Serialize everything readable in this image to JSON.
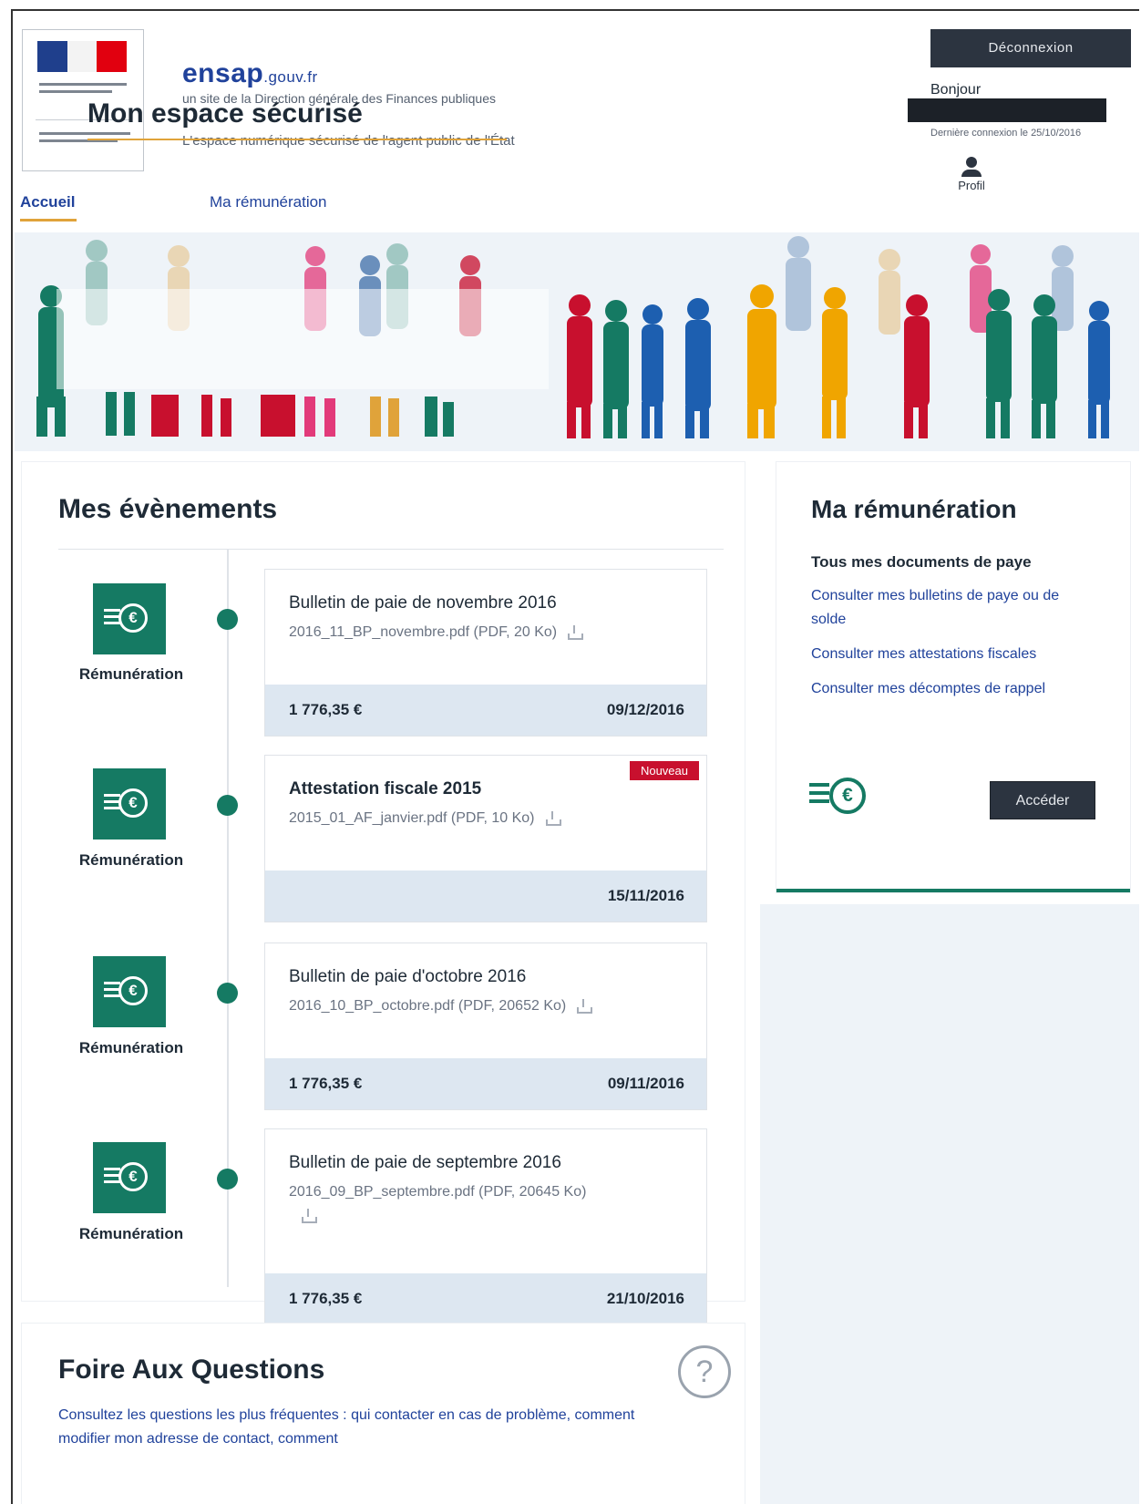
{
  "header": {
    "brand_name": "ensap",
    "brand_domain": ".gouv.fr",
    "brand_subtitle": "un site de la Direction générale des Finances publiques",
    "brand_tagline": "L'espace numérique sécurisé de l'agent public de l'État",
    "logout_label": "Déconnexion",
    "greeting": "Bonjour",
    "last_login": "Dernière connexion le 25/10/2016",
    "profile_label": "Profil"
  },
  "nav": {
    "home": "Accueil",
    "pay": "Ma rémunération"
  },
  "hero": {
    "title": "Mon espace sécurisé"
  },
  "events": {
    "title": "Mes évènements",
    "items": [
      {
        "category": "Rémunération",
        "title": "Bulletin de paie de novembre 2016",
        "file": "2016_11_BP_novembre.pdf (PDF, 20 Ko)",
        "amount": "1 776,35 €",
        "date": "09/12/2016",
        "badge": ""
      },
      {
        "category": "Rémunération",
        "title": "Attestation fiscale 2015",
        "file": "2015_01_AF_janvier.pdf (PDF, 10 Ko)",
        "amount": "",
        "date": "15/11/2016",
        "badge": "Nouveau"
      },
      {
        "category": "Rémunération",
        "title": "Bulletin de paie d'octobre 2016",
        "file": "2016_10_BP_octobre.pdf (PDF, 20652 Ko)",
        "amount": "1 776,35 €",
        "date": "09/11/2016",
        "badge": ""
      },
      {
        "category": "Rémunération",
        "title": "Bulletin de paie de septembre 2016",
        "file": "2016_09_BP_septembre.pdf (PDF, 20645 Ko)",
        "amount": "1 776,35 €",
        "date": "21/10/2016",
        "badge": ""
      }
    ]
  },
  "pay_card": {
    "title": "Ma rémunération",
    "subtitle": "Tous mes documents de paye",
    "links": [
      "Consulter mes bulletins de paye ou de solde",
      "Consulter mes attestations fiscales",
      "Consulter mes décomptes de rappel"
    ],
    "button_label": "Accéder"
  },
  "faq": {
    "title": "Foire Aux Questions",
    "icon": "?",
    "text": "Consultez les questions les plus fréquentes : qui contacter en cas de problème, comment modifier mon adresse de contact, comment"
  },
  "colors": {
    "brand_blue": "#20429b",
    "accent_green": "#157a63",
    "dark_button": "#2c3440",
    "badge_red": "#c8102e",
    "underline_gold": "#e0a33a"
  },
  "icons": {
    "event": "remuneration-coin-icon",
    "profile": "user-icon",
    "download": "download-icon",
    "faq": "question-circle-icon"
  }
}
